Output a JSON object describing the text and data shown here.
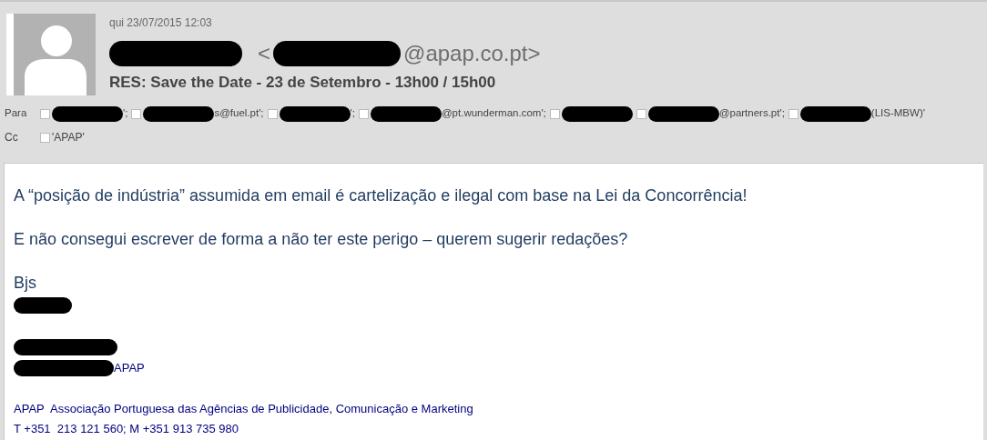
{
  "email": {
    "date": "qui 23/07/2015 12:03",
    "sender": {
      "name_redacted": true,
      "open_bracket": "<",
      "address_redacted": true,
      "domain": "@apap.co.pt>"
    },
    "subject": "RES: Save the Date - 23 de Setembro - 13h00 / 15h00",
    "to": {
      "label": "Para",
      "recipients": [
        {
          "checked": false,
          "redacted": true,
          "text": "';"
        },
        {
          "checked": false,
          "redacted": true,
          "text": "s@fuel.pt';"
        },
        {
          "checked": false,
          "redacted": true,
          "text": "';"
        },
        {
          "checked": false,
          "redacted": true,
          "text": "@pt.wunderman.com';"
        },
        {
          "checked": false,
          "redacted": true
        },
        {
          "checked": false,
          "redacted": true,
          "text": "@partners.pt';"
        },
        {
          "checked": false,
          "redacted": true,
          "text": "(LIS-MBW)'"
        }
      ]
    },
    "cc": {
      "label": "Cc",
      "recipients": [
        {
          "checked": false,
          "text": "'APAP'"
        }
      ]
    }
  },
  "body": {
    "paragraphs": [
      "A “posição de indústria” assumida em email é cartelização e ilegal com base na Lei da Concorrência!",
      "E não consegui escrever de forma a não ter este perigo – querem sugerir redações?"
    ],
    "signoff": "Bjs"
  },
  "signature": {
    "lines": [
      {
        "redacted": true
      },
      {
        "redacted": true
      },
      {
        "redacted": true,
        "text": "APAP"
      }
    ],
    "organization": "APAP  Associação Portuguesa das Agências de Publicidade, Comunicação e Marketing",
    "contacts": "T +351  213 121 560; M +351 913 735 980"
  }
}
